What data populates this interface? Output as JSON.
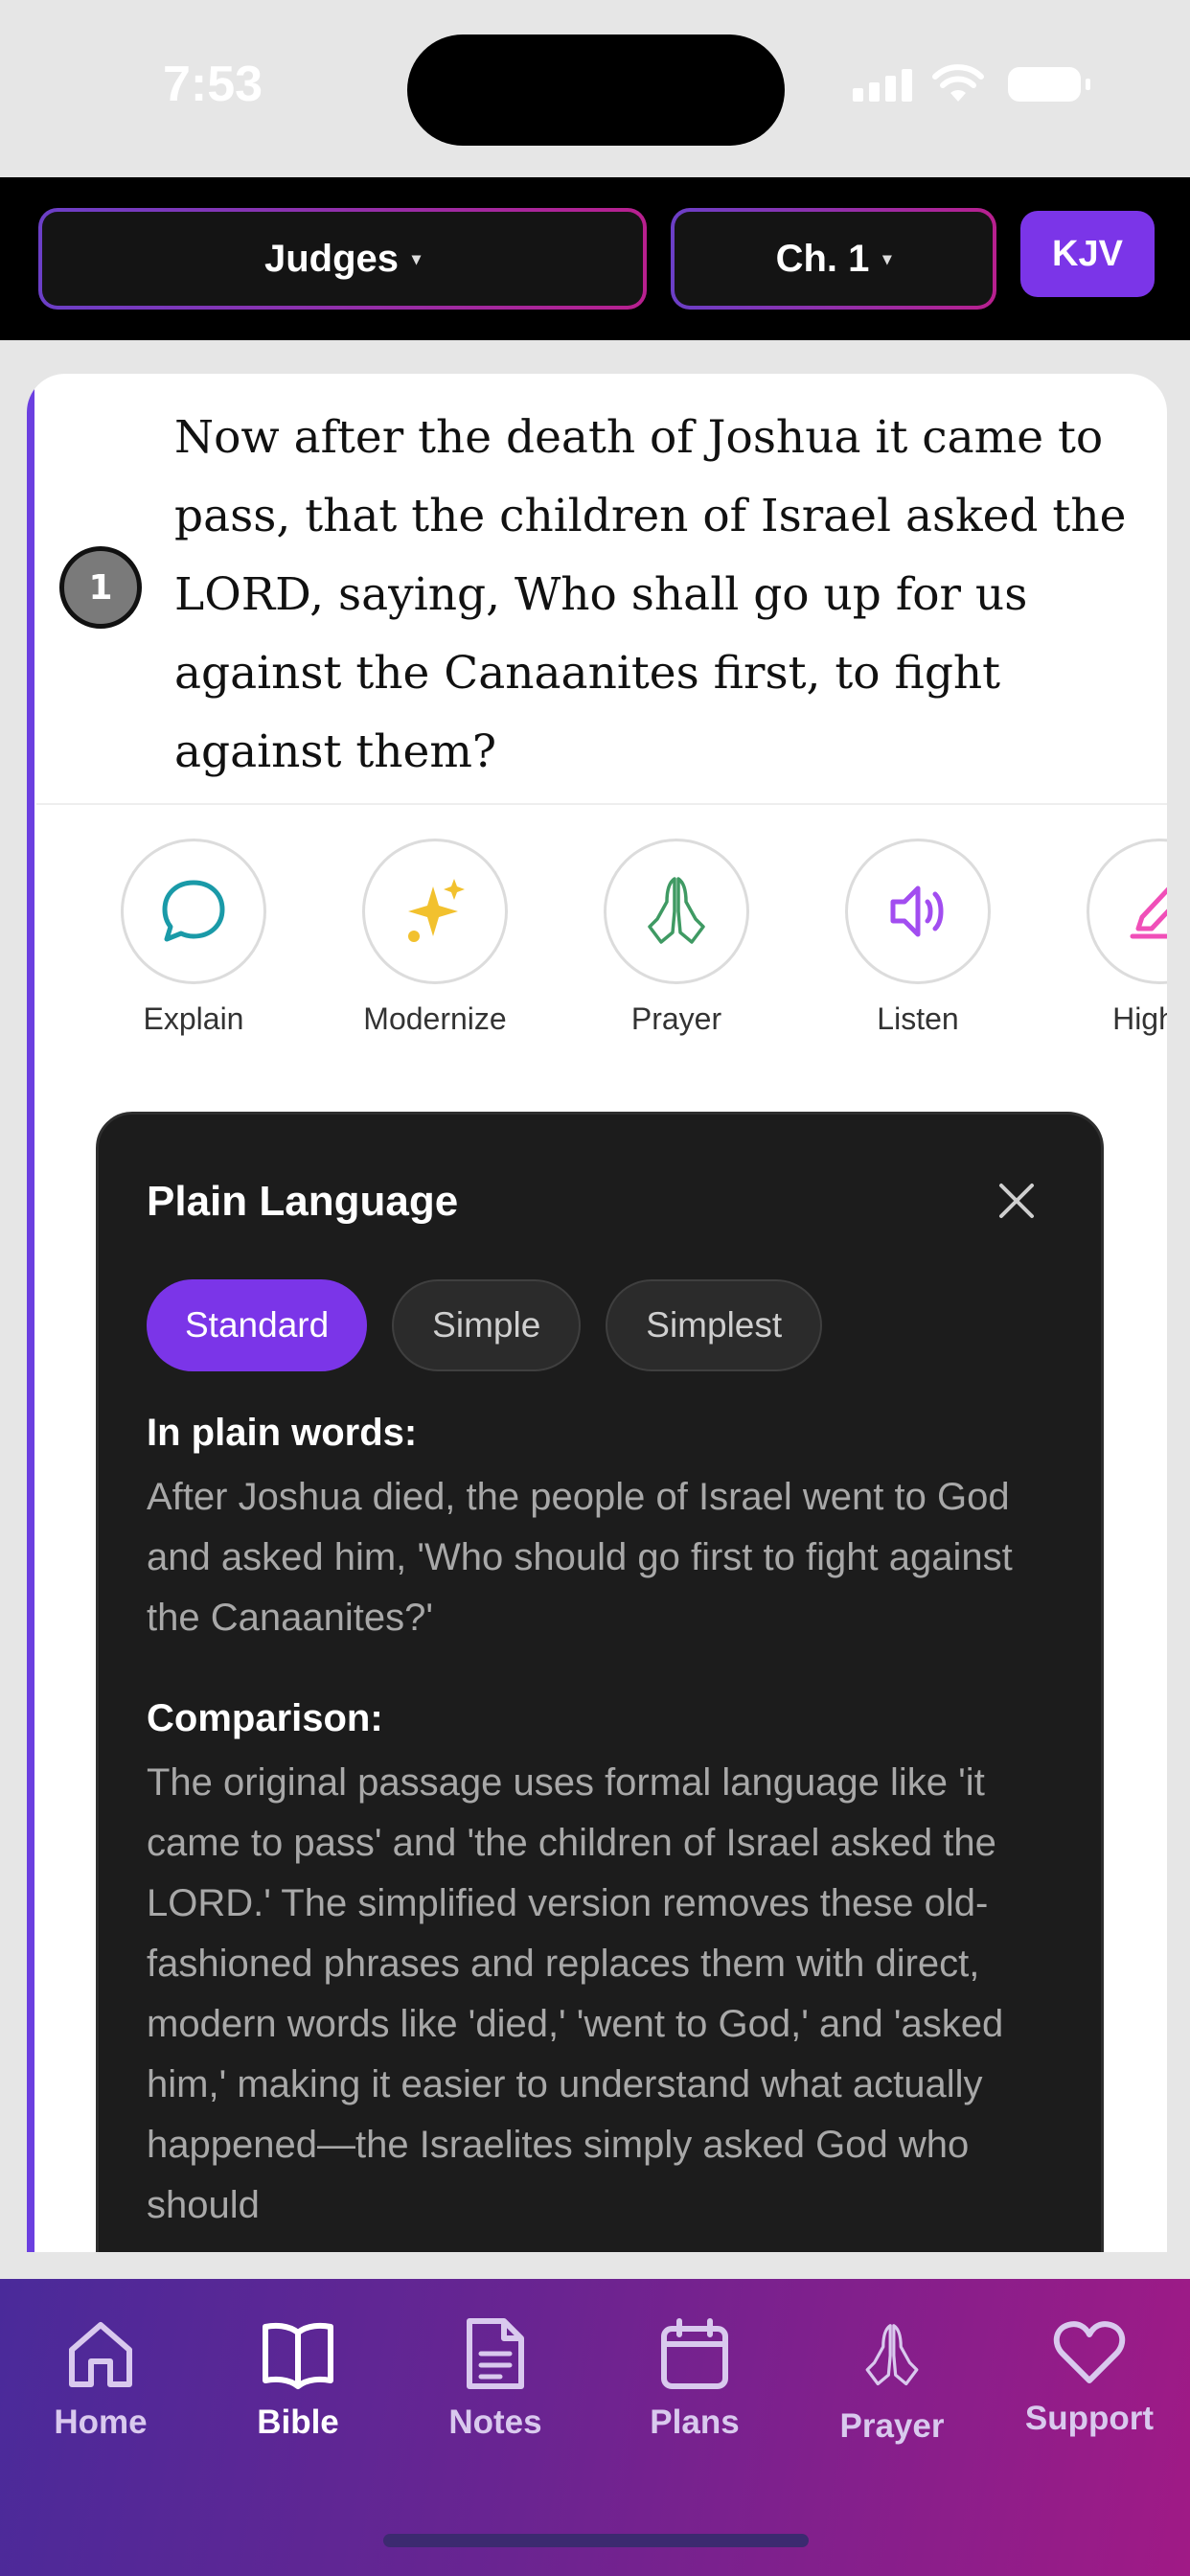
{
  "status": {
    "time": "7:53"
  },
  "header": {
    "book": "Judges",
    "chapter": "Ch. 1",
    "version": "KJV",
    "caret": "▾"
  },
  "verse": {
    "number": "1",
    "text": "Now after the death of Joshua it came to pass, that the children of Israel asked the LORD, saying, Who shall go up for us against the Canaanites first, to fight against them?"
  },
  "actions": [
    {
      "label": "Explain",
      "icon": "chat-bubble-icon",
      "color": "#1a9aa8"
    },
    {
      "label": "Modernize",
      "icon": "sparkle-icon",
      "color": "#f2c12e"
    },
    {
      "label": "Prayer",
      "icon": "praying-hands-icon",
      "color": "#3f9a63"
    },
    {
      "label": "Listen",
      "icon": "speaker-icon",
      "color": "#a24df0"
    },
    {
      "label": "Highlig",
      "icon": "highlighter-icon",
      "color": "#f04fb8"
    }
  ],
  "panel": {
    "title": "Plain Language",
    "modes": [
      "Standard",
      "Simple",
      "Simplest"
    ],
    "active_mode": "Standard",
    "plain_heading": "In plain words:",
    "plain_text": "After Joshua died, the people of Israel went to God and asked him, 'Who should go first to fight against the Canaanites?'",
    "comparison_heading": "Comparison:",
    "comparison_text": "The original passage uses formal language like 'it came to pass' and 'the children of Israel asked the LORD.' The simplified version removes these old-fashioned phrases and replaces them with direct, modern words like 'died,' 'went to God,' and 'asked him,' making it easier to understand what actually happened—the Israelites simply asked God who should"
  },
  "tabs": [
    {
      "label": "Home",
      "icon": "home-icon"
    },
    {
      "label": "Bible",
      "icon": "book-icon",
      "active": true
    },
    {
      "label": "Notes",
      "icon": "document-icon"
    },
    {
      "label": "Plans",
      "icon": "calendar-icon"
    },
    {
      "label": "Prayer",
      "icon": "praying-hands-icon"
    },
    {
      "label": "Support",
      "icon": "heart-icon"
    }
  ],
  "colors": {
    "accent": "#7b35e8",
    "header_bg": "#000000",
    "panel_bg": "#1c1c1c"
  }
}
